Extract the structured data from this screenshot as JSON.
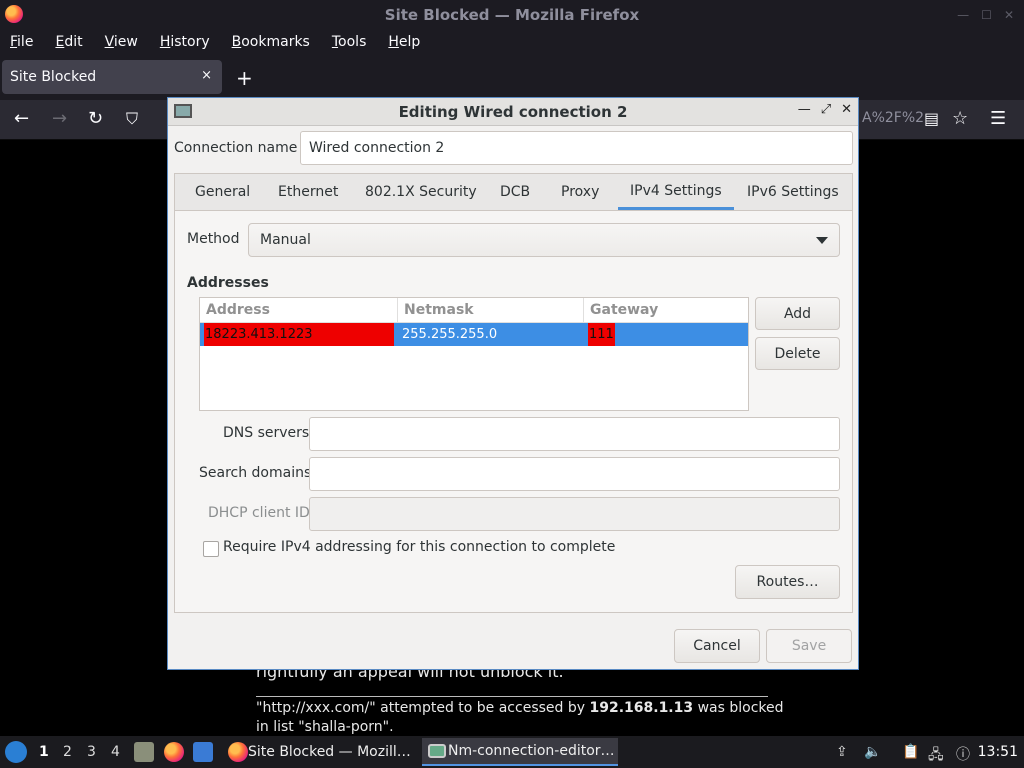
{
  "firefox": {
    "window_title": "Site Blocked — Mozilla Firefox",
    "menu": [
      "File",
      "Edit",
      "View",
      "History",
      "Bookmarks",
      "Tools",
      "Help"
    ],
    "tab_title": "Site Blocked",
    "tab_close": "×",
    "new_tab": "+",
    "url_tail": "A%2F%2",
    "page": {
      "line1": "rightfully an appeal will not unblock it.",
      "line2_pre": "\"http://xxx.com/\" attempted to be accessed by ",
      "line2_ip": "192.168.1.13",
      "line2_post": " was blocked",
      "line3": "in list \"shalla-porn\"."
    }
  },
  "dialog": {
    "title": "Editing Wired connection 2",
    "connection_name_label": "Connection name",
    "connection_name": "Wired connection 2",
    "tabs": [
      "General",
      "Ethernet",
      "802.1X Security",
      "DCB",
      "Proxy",
      "IPv4 Settings",
      "IPv6 Settings"
    ],
    "active_tab": "IPv4 Settings",
    "method_label": "Method",
    "method_value": "Manual",
    "addresses_heading": "Addresses",
    "columns": [
      "Address",
      "Netmask",
      "Gateway"
    ],
    "rows": [
      {
        "address": "18223.413.1223",
        "netmask": "255.255.255.0",
        "gateway": "111"
      }
    ],
    "add_button": "Add",
    "delete_button": "Delete",
    "dns_label": "DNS servers",
    "dns_value": "",
    "search_label": "Search domains",
    "search_value": "",
    "dhcp_label": "DHCP client ID",
    "dhcp_value": "",
    "require_ipv4_label": "Require IPv4 addressing for this connection to complete",
    "require_ipv4_checked": false,
    "routes_button": "Routes…",
    "cancel_button": "Cancel",
    "save_button": "Save"
  },
  "taskbar": {
    "workspaces": [
      "1",
      "2",
      "3",
      "4"
    ],
    "active_workspace": "1",
    "tasks": [
      "Site Blocked — Mozill…",
      "Nm-connection-editor…"
    ],
    "clock": "13:51"
  }
}
